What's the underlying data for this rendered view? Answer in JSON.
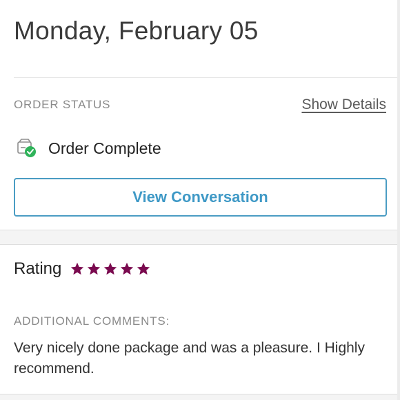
{
  "header": {
    "date": "Monday, February 05"
  },
  "order": {
    "status_label": "ORDER STATUS",
    "show_details_label": "Show Details",
    "status_icon": "package-check-icon",
    "status_text": "Order Complete",
    "view_conversation_label": "View Conversation",
    "accent_color": "#3f99c6",
    "success_color": "#2fb35a"
  },
  "rating": {
    "label": "Rating",
    "stars": 5,
    "max_stars": 5,
    "star_color": "#7a0a4f"
  },
  "comments": {
    "label": "ADDITIONAL COMMENTS:",
    "text": "Very nicely done package and was a pleasure. I Highly recommend."
  }
}
